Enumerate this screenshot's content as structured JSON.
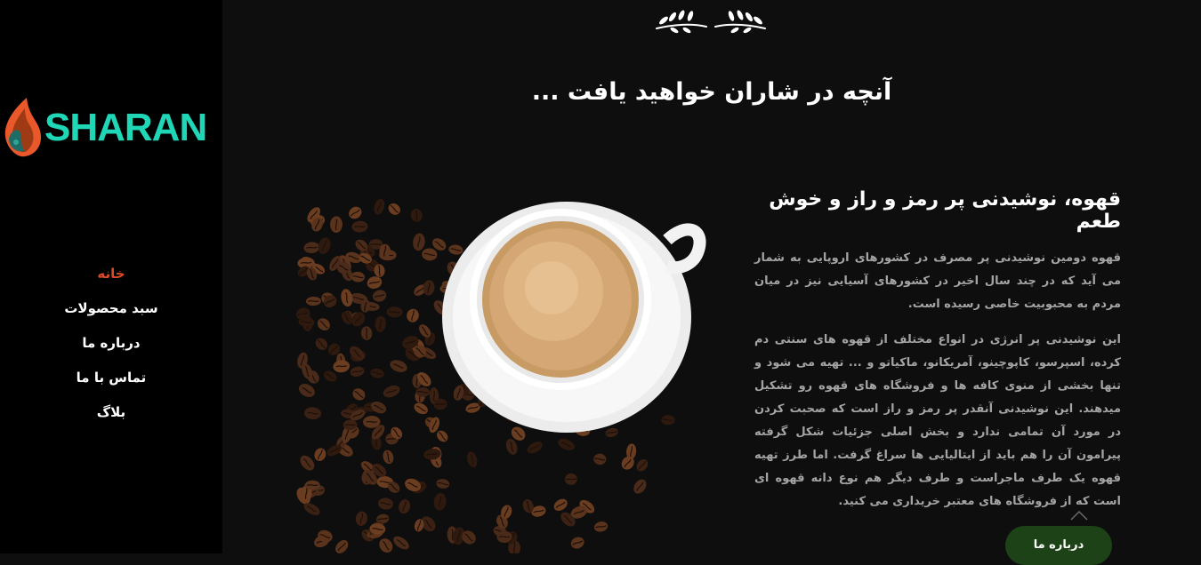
{
  "brand": {
    "name": "SHARAN",
    "color": "#1fd6b6",
    "flame_colors": [
      "#e8582a",
      "#9e3a14",
      "#1f6b66"
    ]
  },
  "nav": {
    "items": [
      {
        "label": "خانه",
        "active": true
      },
      {
        "label": "سبد محصولات",
        "active": false
      },
      {
        "label": "درباره ما",
        "active": false
      },
      {
        "label": "تماس با ما",
        "active": false
      },
      {
        "label": "بلاگ",
        "active": false
      }
    ],
    "active_color": "#d94a26"
  },
  "section": {
    "title": "آنچه در شاران خواهید یافت ..."
  },
  "article": {
    "heading": "قهوه، نوشیدنی پر رمز و راز و خوش طعم",
    "paragraphs": [
      "قهوه دومین نوشیدنی پر مصرف در کشورهای اروپایی به شمار می آید که در چند سال اخیر در کشورهای آسیایی نیز در میان مردم به محبوبیت خاصی رسیده است.",
      "این نوشیدنی پر انرژی در انواع مختلف از قهوه های سنتی دم کرده، اسپرسو، کاپوچینو، آمریکانو، ماکیاتو و ... تهیه می شود و تنها بخشی از منوی کافه ها و فروشگاه های قهوه رو تشکیل میدهند. این نوشیدنی آنقدر پر رمز و راز است که صحبت کردن در مورد آن تمامی ندارد و بخش اصلی جزئیات شکل گرفته پیرامون آن را هم باید از ایتالیایی ها سراغ گرفت. اما طرز تهیه قهوه یک طرف ماجراست و طرف دیگر هم نوع دانه قهوه ای است که از فروشگاه های معتبر خریداری می کنید."
    ]
  },
  "buttons": {
    "about": "درباره ما",
    "about_color": "#1e4217"
  },
  "icons": {
    "ornament": "laurel-branches-icon",
    "scroll_up": "chevron-up-icon",
    "logo": "flame-logo-icon"
  }
}
